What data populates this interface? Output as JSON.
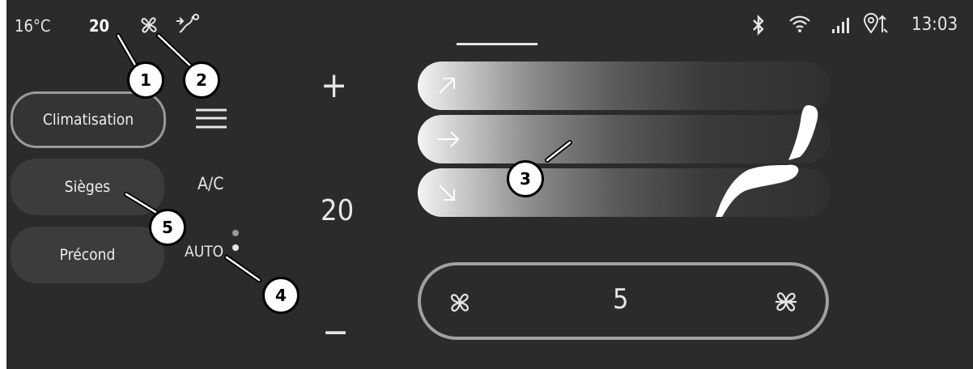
{
  "status_bar": {
    "outside_temp": "16°C",
    "set_temp": "20",
    "time": "13:03",
    "icons": [
      "bluetooth-icon",
      "wifi-icon",
      "signal-icon",
      "location-icon"
    ]
  },
  "side_menu": {
    "items": [
      {
        "label": "Climatisation",
        "active": true
      },
      {
        "label": "Sièges",
        "active": false
      },
      {
        "label": "Précond",
        "active": false
      }
    ]
  },
  "controls": {
    "ac_label": "A/C",
    "auto_label": "AUTO"
  },
  "temperature": {
    "plus": "+",
    "value": "20",
    "minus": "−"
  },
  "fan": {
    "speed": "5"
  },
  "callouts": [
    "1",
    "2",
    "3",
    "4",
    "5"
  ],
  "colors": {
    "background": "#2b2b2b",
    "text": "#e6e6e6",
    "button": "#3c3c3c",
    "active_border": "#9a9a9a"
  }
}
